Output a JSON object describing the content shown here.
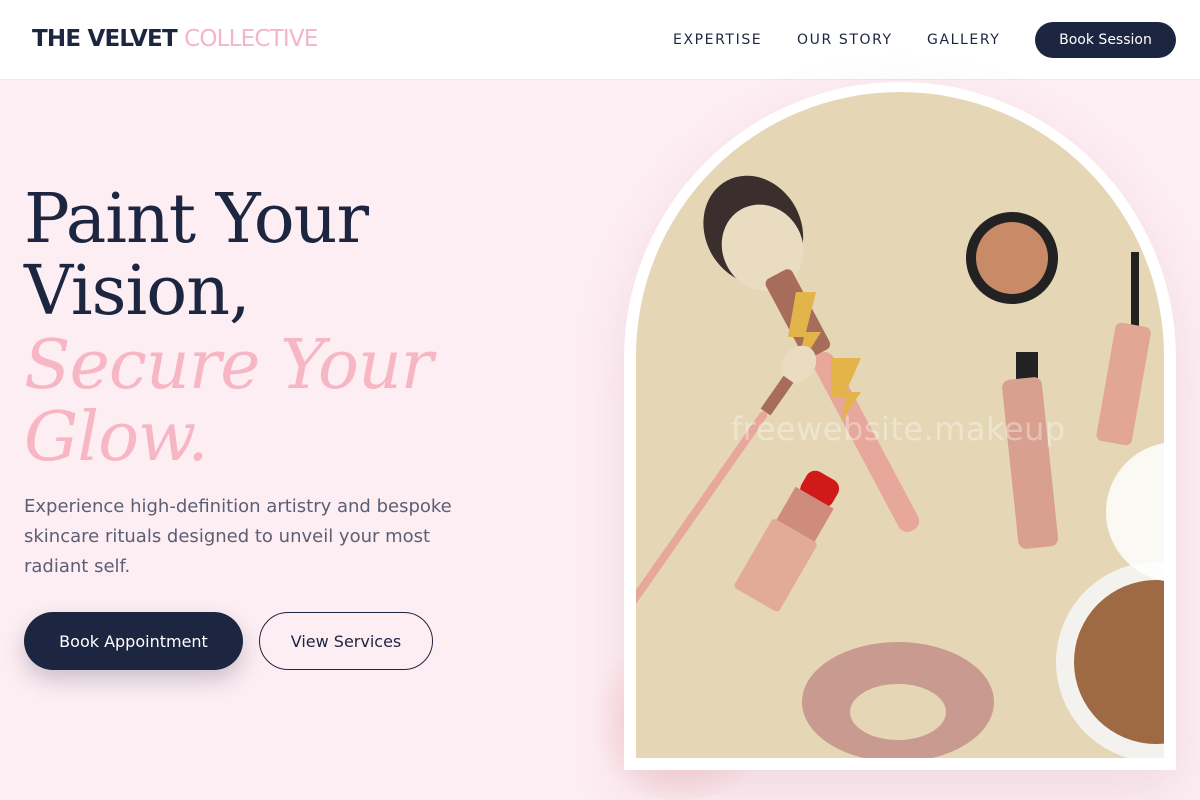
{
  "header": {
    "logo_part1": "THE VELVET",
    "logo_part2": "COLLECTIVE",
    "nav": [
      "EXPERTISE",
      "OUR STORY",
      "GALLERY"
    ],
    "cta": "Book Session"
  },
  "hero": {
    "line1": "Paint Your",
    "line2": "Vision,",
    "line3": "Secure Your",
    "line4": "Glow.",
    "description": "Experience high-definition artistry and bespoke skincare rituals designed to unveil your most radiant self.",
    "primary_button": "Book Appointment",
    "secondary_button": "View Services"
  },
  "image": {
    "watermark": "freewebsite.makeup"
  },
  "colors": {
    "navy": "#1d2640",
    "pink": "#f7b6c4",
    "background": "#fdeef3",
    "image_backdrop": "#e5d7b6"
  }
}
